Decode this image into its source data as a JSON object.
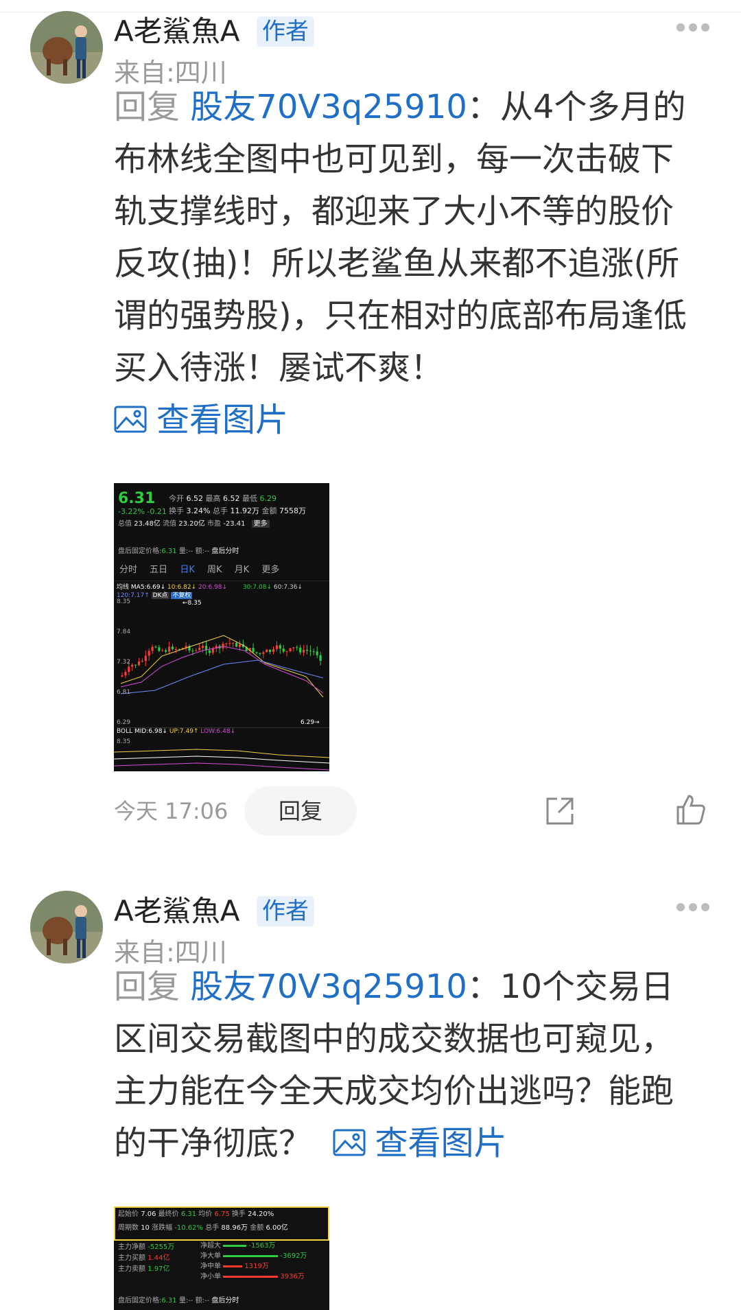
{
  "posts": [
    {
      "author": "A老鯊魚A",
      "badge": "作者",
      "location": "来自:四川",
      "reply_prefix": "回复",
      "mention": "股友70V3q25910",
      "text": "：从4个多月的布林线全图中也可见到，每一次击破下轨支撑线时，都迎来了大小不等的股价反攻(抽)！所以老鲨鱼从来都不追涨(所谓的强势股)，只在相对的底部布局逢低买入待涨！屡试不爽！",
      "view_image": "查看图片",
      "time": "今天 17:06",
      "reply_button": "回复",
      "chart": {
        "price": "6.31",
        "change": "-3.22%  -0.21",
        "open_label": "今开",
        "open": "6.52",
        "high_label": "最高",
        "high": "6.52",
        "low_label": "最低",
        "low": "6.29",
        "turnover_label": "换手",
        "turnover": "3.24%",
        "volume_label": "总手",
        "volume": "11.92万",
        "amount_label": "金额",
        "amount": "7558万",
        "mcap_label": "总值",
        "mcap": "23.48亿",
        "float_label": "流值",
        "float": "23.20亿",
        "pe_label": "市盈",
        "pe": "-23.41",
        "more": "更多",
        "after_label": "盘后固定价格:",
        "after_value": "6.31",
        "qty_label": "量:",
        "qty_value": "--",
        "amt2_label": "额:",
        "amt2_value": "--",
        "after_time": "盘后分时",
        "tabs": [
          "分时",
          "五日",
          "日K",
          "周K",
          "月K",
          "更多"
        ],
        "ma_label": "均线",
        "ma5": "MA5:6.69↓",
        "ma10": "10:6.82↓",
        "ma20": "20:6.98↓",
        "ma30": "30:7.08↓",
        "ma60": "60:7.36↓",
        "ma120": "120:7.17↑",
        "dk": "DK点",
        "adjust": "不复权",
        "y_top": "8.35",
        "y2": "7.84",
        "y3": "7.32",
        "y4": "6.81",
        "y_bottom": "6.29",
        "max_marker": "←8.35",
        "min_marker": "6.29→",
        "boll": "BOLL",
        "boll_mid": "MID:6.98↓",
        "boll_up": "UP:7.49↑",
        "boll_low": "LOW:6.48↓",
        "boll_y": "8.35"
      }
    },
    {
      "author": "A老鯊魚A",
      "badge": "作者",
      "location": "来自:四川",
      "reply_prefix": "回复",
      "mention": "股友70V3q25910",
      "text": "：10个交易日区间交易截图中的成交数据也可窥见，主力能在今全天成交均价出逃吗？能跑的干净彻底？",
      "view_image": "查看图片",
      "stats": {
        "start_label": "起始价",
        "start": "7.06",
        "end_label": "最终价",
        "end": "6.31",
        "avg_label": "均价",
        "avg": "6.75",
        "turn_label": "换手",
        "turn": "24.20%",
        "days_label": "周期数",
        "days": "10",
        "chg_label": "涨跌幅",
        "chg": "-10.62%",
        "vol_label": "总手",
        "vol": "88.96万",
        "amt_label": "金额",
        "amt": "6.00亿",
        "net_label": "主力净额",
        "net": "-5255万",
        "buy_label": "主力买额",
        "buy": "1.44亿",
        "sell_label": "主力卖额",
        "sell": "1.97亿",
        "xl_label": "净超大",
        "xl": "-1563万",
        "l_label": "净大单",
        "l": "-3692万",
        "m_label": "净中单",
        "m": "1319万",
        "s_label": "净小单",
        "s": "3936万",
        "after_label": "盘后固定价格:",
        "after_value": "6.31",
        "qty_label": "量:",
        "qty_value": "--",
        "amt2_label": "额:",
        "amt2_value": "--",
        "after_time": "盘后分时"
      }
    }
  ]
}
